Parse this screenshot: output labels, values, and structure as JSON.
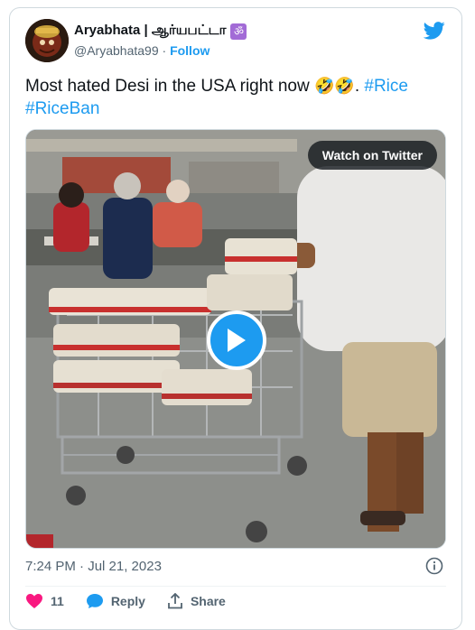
{
  "tweet": {
    "author_name": "Aryabhata | ஆர்யபட்டா",
    "author_badge": "ॐ",
    "handle": "@Aryabhata99",
    "separator": " · ",
    "follow_label": "Follow",
    "text_main": "Most hated Desi in the USA right now ",
    "emoji": "🤣🤣",
    "text_after_emoji": ". ",
    "hashtag_1": "#Rice",
    "hashtag_2": "#RiceBan",
    "timestamp": "7:24 PM · Jul 21, 2023"
  },
  "media": {
    "watch_label": "Watch on Twitter",
    "play_icon": "play-icon"
  },
  "actions": {
    "like_count": "11",
    "reply_label": "Reply",
    "share_label": "Share"
  },
  "colors": {
    "accent": "#1d9bf0",
    "like": "#f91880",
    "muted": "#536471"
  }
}
